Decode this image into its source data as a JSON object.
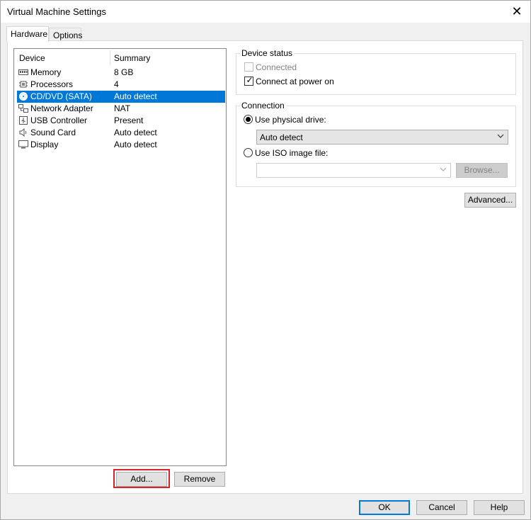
{
  "window": {
    "title": "Virtual Machine Settings",
    "close_glyph": "✕"
  },
  "tabs": [
    {
      "label": "Hardware",
      "active": true
    },
    {
      "label": "Options",
      "active": false
    }
  ],
  "device_list": {
    "columns": {
      "device": "Device",
      "summary": "Summary"
    },
    "rows": [
      {
        "name": "Memory",
        "summary": "8 GB",
        "icon": "memory-icon"
      },
      {
        "name": "Processors",
        "summary": "4",
        "icon": "processor-icon"
      },
      {
        "name": "CD/DVD (SATA)",
        "summary": "Auto detect",
        "icon": "cd-dvd-icon",
        "selected": true
      },
      {
        "name": "Network Adapter",
        "summary": "NAT",
        "icon": "network-adapter-icon"
      },
      {
        "name": "USB Controller",
        "summary": "Present",
        "icon": "usb-icon"
      },
      {
        "name": "Sound Card",
        "summary": "Auto detect",
        "icon": "speaker-icon"
      },
      {
        "name": "Display",
        "summary": "Auto detect",
        "icon": "monitor-icon"
      }
    ]
  },
  "buttons": {
    "add": "Add...",
    "remove": "Remove",
    "advanced": "Advanced...",
    "ok": "OK",
    "cancel": "Cancel",
    "help": "Help",
    "browse": "Browse..."
  },
  "device_status": {
    "title": "Device status",
    "connected": {
      "label": "Connected",
      "checked": false,
      "enabled": false
    },
    "connect_at_power_on": {
      "label": "Connect at power on",
      "checked": true,
      "enabled": true
    }
  },
  "connection": {
    "title": "Connection",
    "use_physical_drive": {
      "label": "Use physical drive:",
      "selected": true
    },
    "physical_drive_value": "Auto detect",
    "use_iso_image": {
      "label": "Use ISO image file:",
      "selected": false
    },
    "iso_path_value": ""
  },
  "colors": {
    "selection": "#0078d7",
    "highlight_box": "#d8212a"
  }
}
